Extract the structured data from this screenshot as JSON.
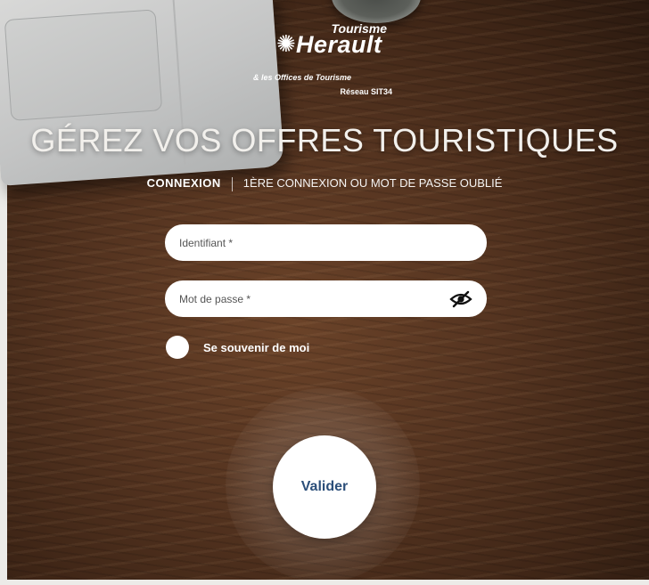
{
  "logo": {
    "tourisme": "Tourisme",
    "herault": "Herault",
    "offices": "& les Offices de Tourisme",
    "reseau": "Réseau SIT34"
  },
  "title": "GÉREZ VOS OFFRES TOURISTIQUES",
  "tabs": {
    "connexion": "CONNEXION",
    "first": "1ÈRE CONNEXION OU MOT DE PASSE OUBLIÉ"
  },
  "form": {
    "identifiant": {
      "placeholder": "Identifiant *",
      "value": ""
    },
    "password": {
      "placeholder": "Mot de passe *",
      "value": ""
    },
    "remember_label": "Se souvenir de moi",
    "remember_checked": false,
    "submit_label": "Valider"
  },
  "icons": {
    "password_toggle": "eye-slash-icon",
    "logo_mark": "sun-icon"
  },
  "colors": {
    "submit_text": "#2c4f7a",
    "text_on_background": "#ffffff"
  }
}
